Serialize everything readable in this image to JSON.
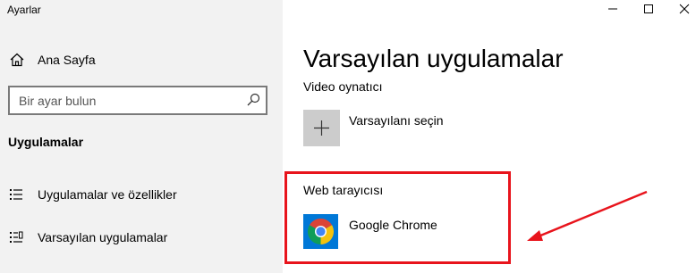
{
  "window": {
    "title": "Ayarlar",
    "controls": [
      "minimize-icon",
      "maximize-icon",
      "close-icon"
    ]
  },
  "sidebar": {
    "home_label": "Ana Sayfa",
    "home_icon": "home-icon",
    "search_placeholder": "Bir ayar bulun",
    "search_icon": "search-icon",
    "section_title": "Uygulamalar",
    "items": [
      {
        "label": "Uygulamalar ve özellikler",
        "icon": "apps-list-icon"
      },
      {
        "label": "Varsayılan uygulamalar",
        "icon": "default-apps-icon"
      }
    ]
  },
  "main": {
    "title": "Varsayılan uygulamalar",
    "video_player_label": "Video oynatıcı",
    "video_player_choice": "Varsayılanı seçin",
    "web_browser_label": "Web tarayıcısı",
    "web_browser_app": "Google Chrome"
  },
  "colors": {
    "highlight": "#e8141c",
    "sidebar_bg": "#f2f2f2",
    "tile_gray": "#cccccc",
    "tile_blue": "#0078d7"
  }
}
